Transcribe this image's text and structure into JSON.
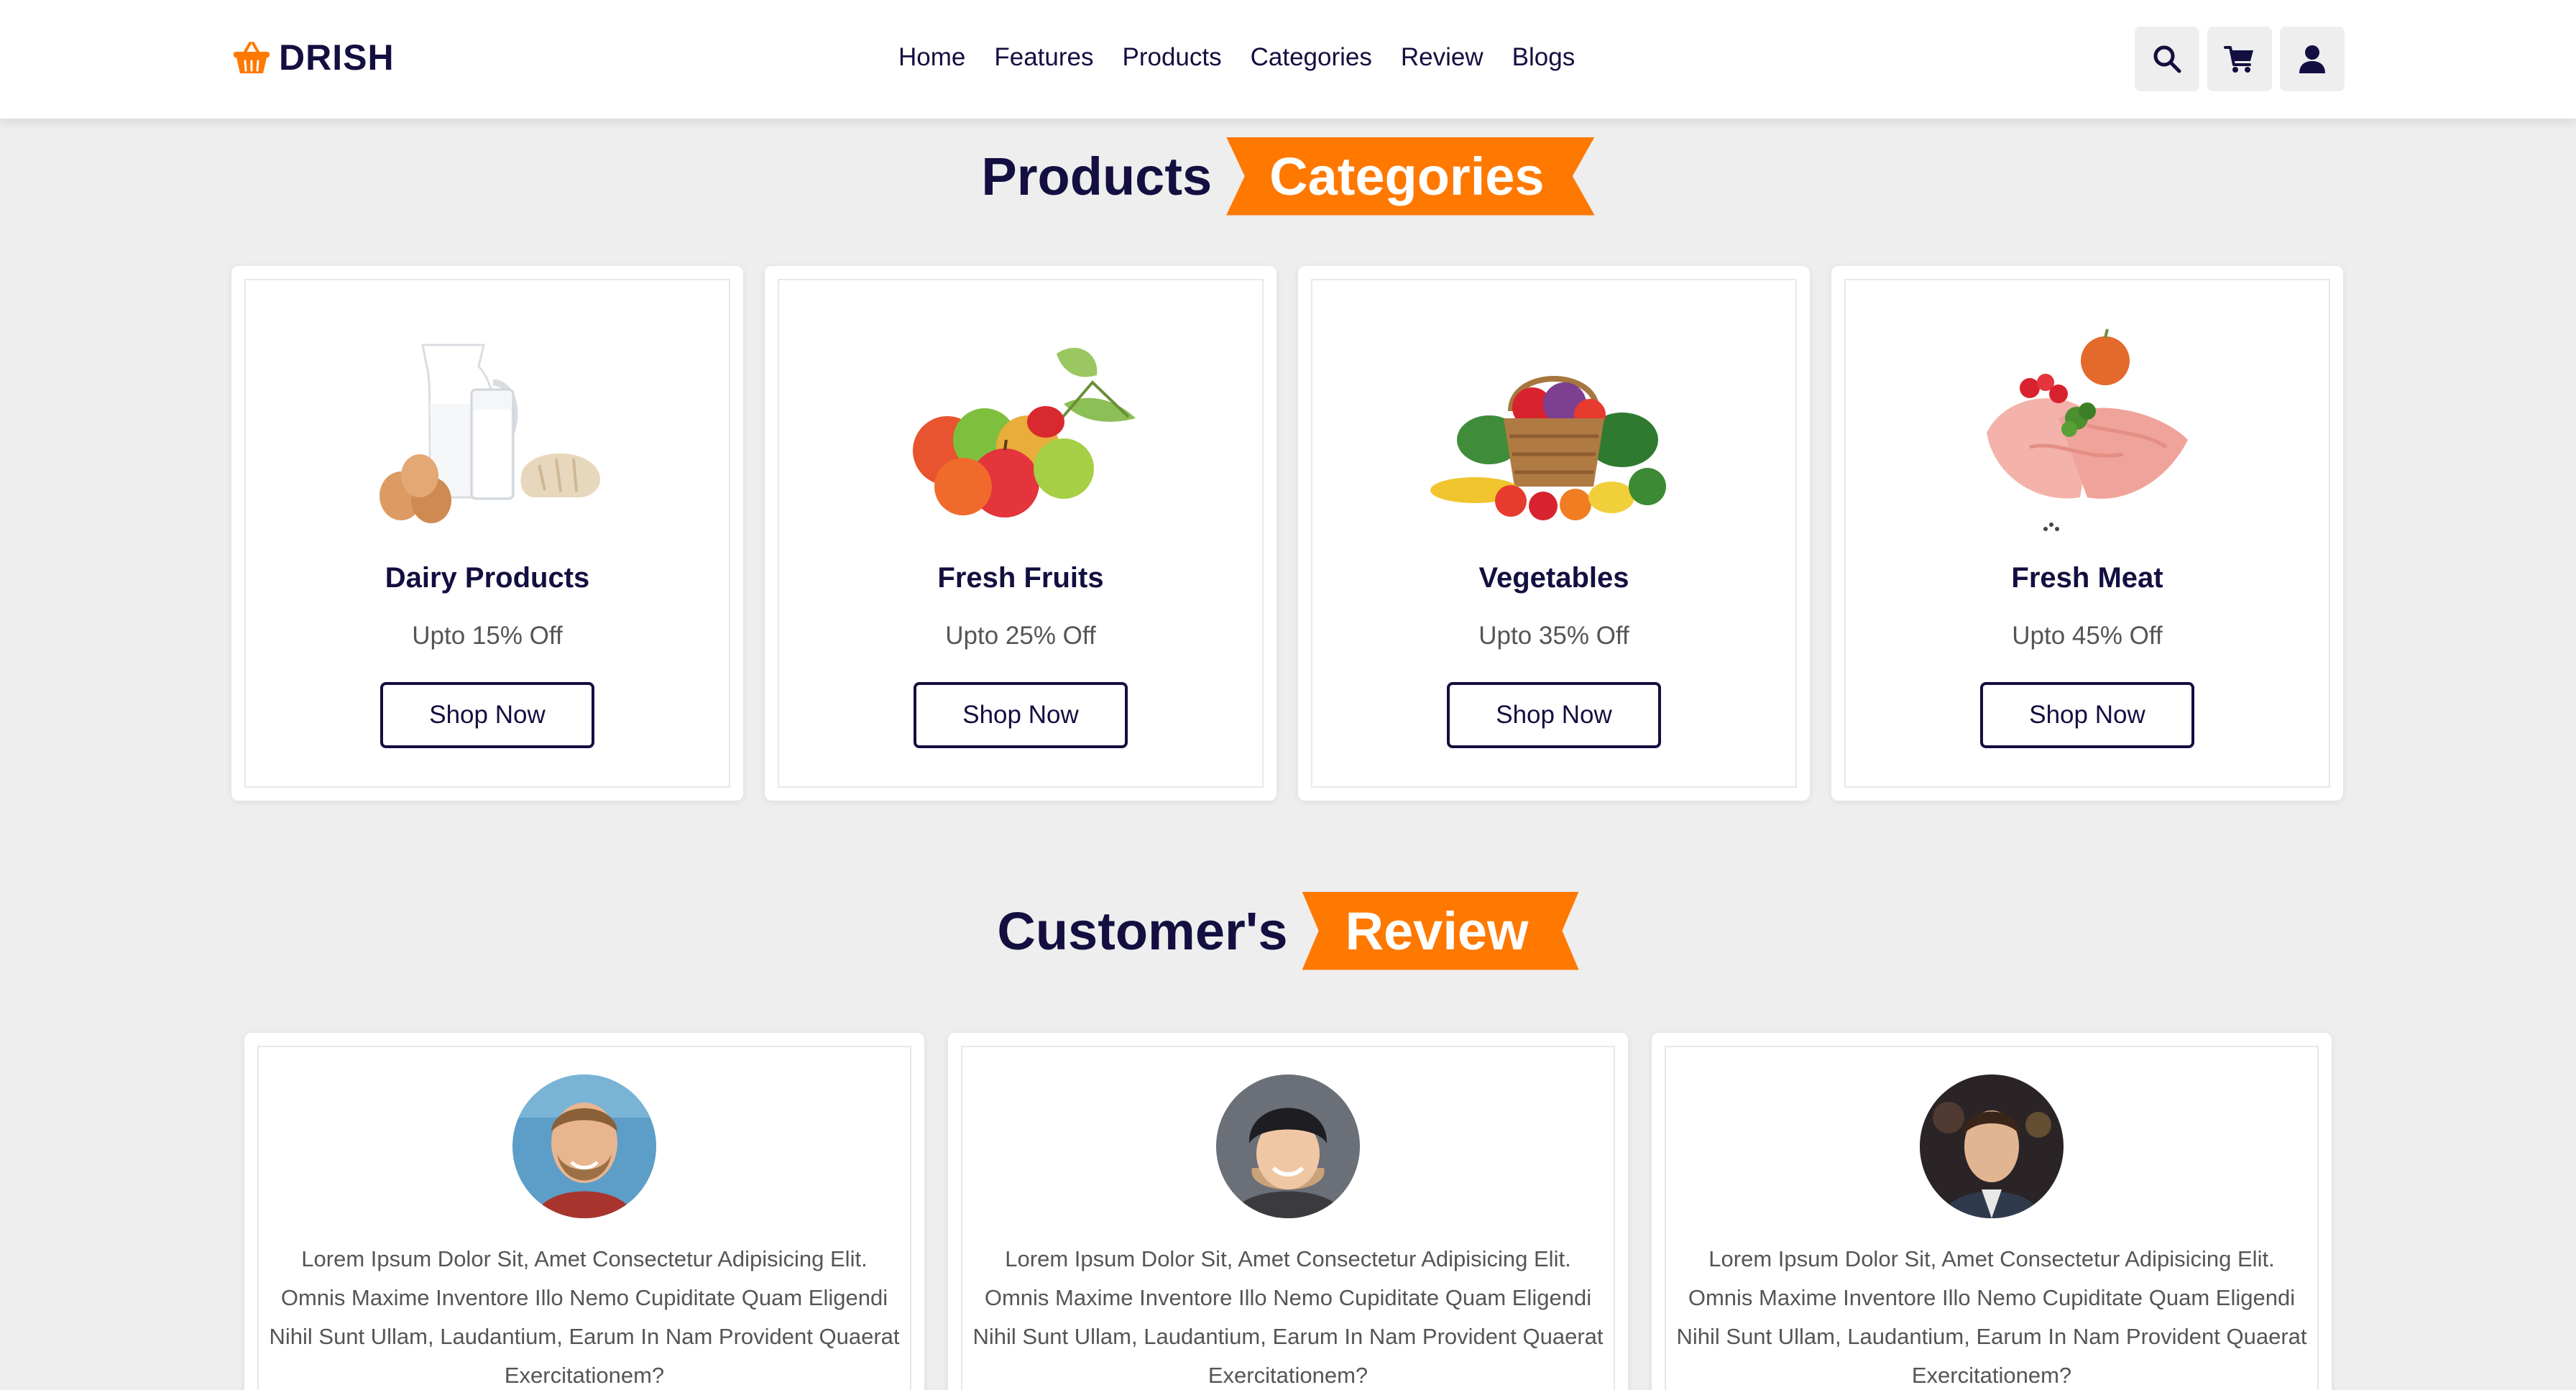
{
  "brand": {
    "name": "DRISH",
    "icon": "basket-icon",
    "accent": "#ff7800",
    "dark": "#130f40"
  },
  "nav": [
    "Home",
    "Features",
    "Products",
    "Categories",
    "Review",
    "Blogs"
  ],
  "header_icons": [
    "search-icon",
    "cart-icon",
    "user-icon"
  ],
  "categories_heading": {
    "dark": "Products",
    "highlight": "Categories"
  },
  "categories": [
    {
      "title": "Dairy Products",
      "offer": "Upto 15% Off",
      "button": "Shop Now",
      "image": "dairy-image"
    },
    {
      "title": "Fresh Fruits",
      "offer": "Upto 25% Off",
      "button": "Shop Now",
      "image": "fruits-image"
    },
    {
      "title": "Vegetables",
      "offer": "Upto 35% Off",
      "button": "Shop Now",
      "image": "vegetables-image"
    },
    {
      "title": "Fresh Meat",
      "offer": "Upto 45% Off",
      "button": "Shop Now",
      "image": "meat-image"
    }
  ],
  "review_heading": {
    "dark": "Customer's",
    "highlight": "Review"
  },
  "reviews": [
    {
      "avatar": "customer-avatar-1",
      "text": "Lorem Ipsum Dolor Sit, Amet Consectetur Adipisicing Elit. Omnis Maxime Inventore Illo Nemo Cupiditate Quam Eligendi Nihil Sunt Ullam, Laudantium, Earum In Nam Provident Quaerat Exercitationem?"
    },
    {
      "avatar": "customer-avatar-2",
      "text": "Lorem Ipsum Dolor Sit, Amet Consectetur Adipisicing Elit. Omnis Maxime Inventore Illo Nemo Cupiditate Quam Eligendi Nihil Sunt Ullam, Laudantium, Earum In Nam Provident Quaerat Exercitationem?"
    },
    {
      "avatar": "customer-avatar-3",
      "text": "Lorem Ipsum Dolor Sit, Amet Consectetur Adipisicing Elit. Omnis Maxime Inventore Illo Nemo Cupiditate Quam Eligendi Nihil Sunt Ullam, Laudantium, Earum In Nam Provident Quaerat Exercitationem?"
    }
  ]
}
